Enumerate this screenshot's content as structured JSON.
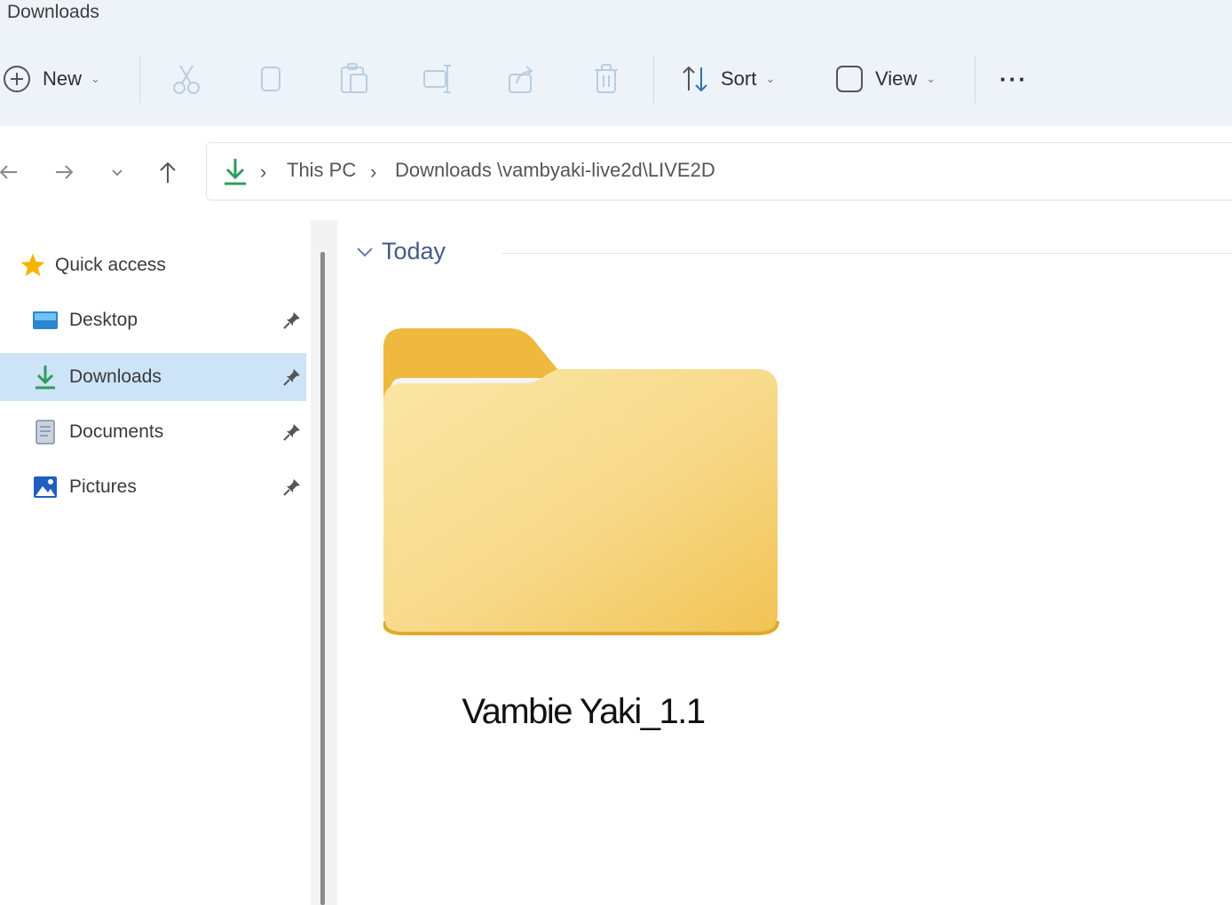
{
  "window": {
    "title": "Downloads"
  },
  "toolbar": {
    "new_label": "New",
    "sort_label": "Sort",
    "view_label": "View",
    "more_label": "···"
  },
  "address": {
    "location_icon": "download-icon",
    "segments": [
      "This PC",
      "Downloads \\vambyaki-live2d\\LIVE2D"
    ]
  },
  "nav": {
    "quick_access_label": "Quick access",
    "items": [
      {
        "label": "Desktop",
        "icon": "desktop-icon",
        "pinned": true,
        "selected": false
      },
      {
        "label": "Downloads",
        "icon": "download-icon",
        "pinned": true,
        "selected": true
      },
      {
        "label": "Documents",
        "icon": "documents-icon",
        "pinned": true,
        "selected": false
      },
      {
        "label": "Pictures",
        "icon": "pictures-icon",
        "pinned": true,
        "selected": false
      }
    ]
  },
  "content": {
    "group_label": "Today",
    "items": [
      {
        "name": "Vambie Yaki_1.1",
        "icon": "folder-icon"
      }
    ]
  },
  "colors": {
    "chrome_bg": "#eef3f9",
    "selection_bg": "#cde3f8",
    "folder_front": "#f5d278",
    "folder_back": "#efb940",
    "accent_green": "#2e9d5a"
  }
}
